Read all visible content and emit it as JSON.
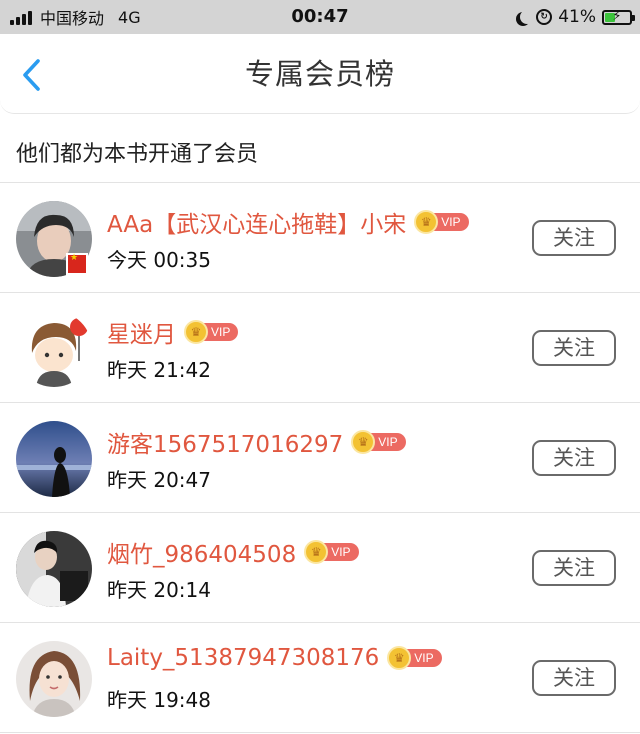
{
  "status_bar": {
    "carrier": "中国移动",
    "network": "4G",
    "time": "00:47",
    "battery_percent": "41%",
    "battery_level": 0.41
  },
  "nav": {
    "back_icon": "chevron-left-icon",
    "title": "专属会员榜"
  },
  "subtitle": "他们都为本书开通了会员",
  "colors": {
    "name": "#e0573f",
    "accent_back": "#2a9cf0",
    "vip_tag": "#ec6a62",
    "crown": "#f3c233"
  },
  "members": [
    {
      "name": "AAa【武汉心连心拖鞋】小宋",
      "vip_label": "VIP",
      "time": "今天 00:35",
      "follow_label": "关注",
      "flag": true
    },
    {
      "name": "星迷月",
      "vip_label": "VIP",
      "time": "昨天 21:42",
      "follow_label": "关注",
      "flag": false
    },
    {
      "name": "游客1567517016297",
      "vip_label": "VIP",
      "time": "昨天 20:47",
      "follow_label": "关注",
      "flag": false
    },
    {
      "name": "烟竹_986404508",
      "vip_label": "VIP",
      "time": "昨天 20:14",
      "follow_label": "关注",
      "flag": false
    },
    {
      "name": "Laity_51387947308176",
      "vip_label": "VIP",
      "time": "昨天 19:48",
      "follow_label": "关注",
      "flag": false
    }
  ]
}
